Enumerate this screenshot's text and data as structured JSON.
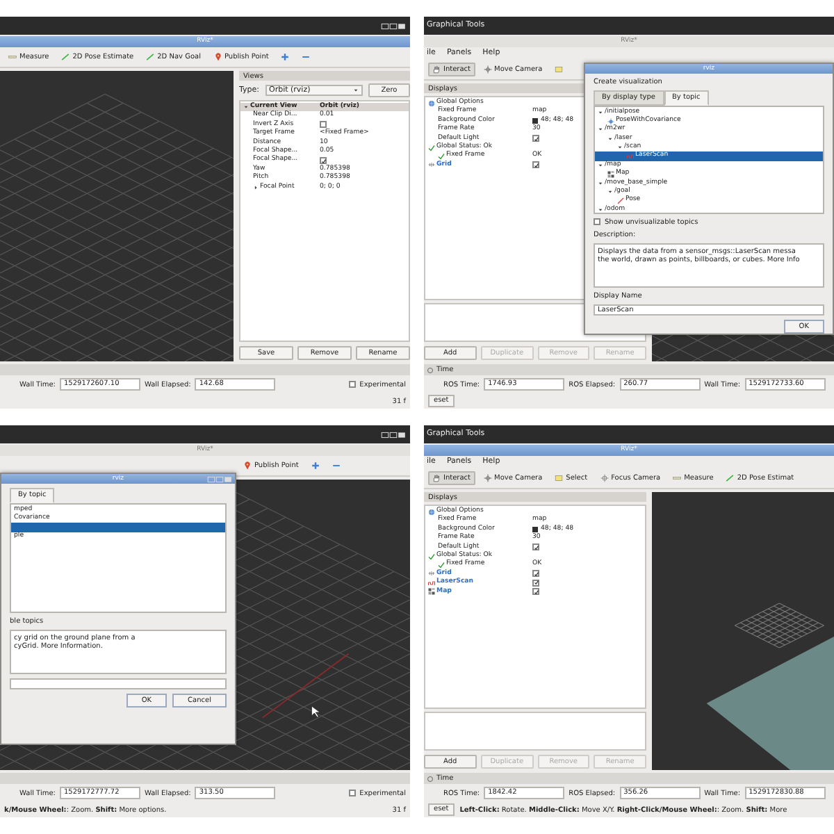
{
  "panels": [
    {
      "window_buttons": true,
      "rviz_title": {
        "text": "RViz*",
        "focused": true
      },
      "tools": [
        {
          "kind": "measure",
          "label": "Measure",
          "selected": false
        },
        {
          "kind": "pose-estimate",
          "label": "2D Pose Estimate",
          "selected": false
        },
        {
          "kind": "nav-goal",
          "label": "2D Nav Goal",
          "selected": false
        },
        {
          "kind": "point",
          "label": "Publish Point",
          "selected": false
        },
        {
          "kind": "plus",
          "selected": false
        },
        {
          "kind": "minus",
          "selected": false
        }
      ],
      "scene": {
        "kind": "grid"
      },
      "views": {
        "title": "Views",
        "type_label": "Type:",
        "type_value": "Orbit (rviz)",
        "zero_button": "Zero",
        "tree": [
          {
            "label": "Current View",
            "value": "Orbit (rviz)",
            "expanded": true,
            "children": [
              {
                "label": "Near Clip Di...",
                "value": "0.01"
              },
              {
                "label": "Invert Z Axis",
                "checked": false
              },
              {
                "label": "Target Frame",
                "value": "<Fixed Frame>"
              },
              {
                "label": "Distance",
                "value": "10"
              },
              {
                "label": "Focal Shape...",
                "value": "0.05"
              },
              {
                "label": "Focal Shape...",
                "checked": true
              },
              {
                "label": "Yaw",
                "value": "0.785398"
              },
              {
                "label": "Pitch",
                "value": "0.785398"
              },
              {
                "label": "Focal Point",
                "value": "0; 0; 0",
                "expanded": false
              }
            ]
          }
        ],
        "buttons": [
          {
            "label": "Save",
            "disabled": false
          },
          {
            "label": "Remove",
            "disabled": false
          },
          {
            "label": "Rename",
            "disabled": false
          }
        ]
      },
      "time": {
        "fields": [
          {
            "label": "Wall Time:",
            "value": "1529172607.10"
          },
          {
            "label": "Wall Elapsed:",
            "value": "142.68"
          }
        ],
        "experimental": {
          "label": "Experimental",
          "checked": false
        }
      },
      "status": {
        "fps": "31 f"
      }
    },
    {
      "window_title": "Graphical Tools",
      "rviz_title": {
        "text": "RViz*",
        "focused": false
      },
      "menu": [
        "ile",
        "Panels",
        "Help"
      ],
      "tools": [
        {
          "kind": "hand",
          "label": "Interact",
          "selected": true
        },
        {
          "kind": "move",
          "label": "Move Camera",
          "selected": false
        },
        {
          "kind": "select",
          "selected": false
        }
      ],
      "scene": {
        "kind": "grid"
      },
      "displays": {
        "title": "Displays",
        "tree": [
          {
            "kind": "options",
            "label": "Global Options",
            "children": [
              {
                "kind": "property",
                "label": "Fixed Frame",
                "value": "map"
              },
              {
                "kind": "property",
                "label": "Background Color",
                "value": "48; 48; 48",
                "color": "#303030"
              },
              {
                "kind": "property",
                "label": "Frame Rate",
                "value": "30"
              },
              {
                "kind": "property",
                "label": "Default Light",
                "checked": true
              }
            ]
          },
          {
            "kind": "status",
            "label": "Global Status: Ok",
            "children": [
              {
                "kind": "status",
                "label": "Fixed Frame",
                "value": "OK"
              }
            ]
          },
          {
            "kind": "grid",
            "label": "Grid",
            "checked": true
          }
        ],
        "buttons": [
          {
            "label": "Add",
            "disabled": false
          },
          {
            "label": "Duplicate",
            "disabled": true
          },
          {
            "label": "Remove",
            "disabled": true
          },
          {
            "label": "Rename",
            "disabled": true
          }
        ]
      },
      "dialog": {
        "title": "rviz",
        "heading": "Create visualization",
        "tabs": [
          {
            "label": "By display type",
            "selected": false
          },
          {
            "label": "By topic",
            "selected": true
          }
        ],
        "tree": [
          {
            "label": "/initialpose",
            "expanded": true,
            "selected": false,
            "children": [
              {
                "kind": "covariance",
                "label": "PoseWithCovariance",
                "selected": false
              }
            ]
          },
          {
            "label": "/m2wr",
            "expanded": true,
            "selected": false,
            "children": [
              {
                "label": "/laser",
                "expanded": true,
                "selected": false,
                "children": [
                  {
                    "label": "/scan",
                    "expanded": true,
                    "selected": false,
                    "children": [
                      {
                        "kind": "laser",
                        "label": "LaserScan",
                        "selected": true
                      }
                    ]
                  }
                ]
              }
            ]
          },
          {
            "label": "/map",
            "expanded": true,
            "selected": false,
            "children": [
              {
                "kind": "map",
                "label": "Map",
                "selected": false
              }
            ]
          },
          {
            "label": "/move_base_simple",
            "expanded": true,
            "selected": false,
            "children": [
              {
                "label": "/goal",
                "expanded": true,
                "selected": false,
                "children": [
                  {
                    "kind": "pose",
                    "label": "Pose",
                    "selected": false
                  }
                ]
              }
            ]
          },
          {
            "label": "/odom",
            "expanded": true,
            "selected": false
          }
        ],
        "show_unvisualizable": {
          "label": "Show unvisualizable topics",
          "checked": false
        },
        "description_label": "Description:",
        "description": {
          "lines": [
            "Displays the data from a sensor_msgs::LaserScan messa",
            "the world, drawn as points, billboards, or cubes."
          ],
          "link": "More Info"
        },
        "name_label": "Display Name",
        "name_value": "LaserScan",
        "buttons": [
          "OK"
        ]
      },
      "time": {
        "title": "Time",
        "fields": [
          {
            "label": "ROS Time:",
            "value": "1746.93"
          },
          {
            "label": "ROS Elapsed:",
            "value": "260.77"
          },
          {
            "label": "Wall Time:",
            "value": "1529172733.60"
          }
        ]
      },
      "status": {
        "button": "eset"
      }
    },
    {
      "window_buttons": true,
      "rviz_title": {
        "text": "RViz*",
        "focused": false
      },
      "tools": [
        {
          "kind": "point",
          "label": "Publish Point",
          "selected": false
        },
        {
          "kind": "plus",
          "selected": false
        },
        {
          "kind": "minus",
          "selected": false
        }
      ],
      "scene": {
        "kind": "grid-axis"
      },
      "dialog": {
        "title": "rviz",
        "window_buttons": true,
        "tabs": [
          {
            "label": "By topic",
            "selected": true
          }
        ],
        "tree": [
          {
            "label": "mped",
            "selected": false
          },
          {
            "label": "Covariance",
            "selected": false
          },
          {
            "selected": true
          },
          {
            "label": "ple",
            "selected": false
          }
        ],
        "show_unvisualizable": {
          "label": "ble topics"
        },
        "description": {
          "lines": [
            "cy grid on the ground plane from a",
            "cyGrid."
          ],
          "link": "More Information",
          "after": "."
        },
        "buttons": [
          "OK",
          "Cancel"
        ]
      },
      "time": {
        "fields": [
          {
            "label": "Wall Time:",
            "value": "1529172777.72"
          },
          {
            "label": "Wall Elapsed:",
            "value": "313.50"
          }
        ],
        "experimental": {
          "label": "Experimental",
          "checked": false
        }
      },
      "status": {
        "text": "**k/Mouse Wheel:**: Zoom. **Shift:** More options.",
        "fps": "31 f"
      }
    },
    {
      "window_title": "Graphical Tools",
      "rviz_title": {
        "text": "RViz*",
        "focused": true
      },
      "menu": [
        "ile",
        "Panels",
        "Help"
      ],
      "tools": [
        {
          "kind": "hand",
          "label": "Interact",
          "selected": true
        },
        {
          "kind": "move",
          "label": "Move Camera",
          "selected": false
        },
        {
          "kind": "select",
          "label": "Select",
          "selected": false
        },
        {
          "kind": "focus",
          "label": "Focus Camera",
          "selected": false
        },
        {
          "kind": "measure",
          "label": "Measure",
          "selected": false
        },
        {
          "kind": "pose-estimate",
          "label": "2D Pose Estimat",
          "selected": false
        }
      ],
      "scene": {
        "kind": "map"
      },
      "displays": {
        "title": "Displays",
        "tree": [
          {
            "kind": "options",
            "label": "Global Options",
            "children": [
              {
                "kind": "property",
                "label": "Fixed Frame",
                "value": "map"
              },
              {
                "kind": "property",
                "label": "Background Color",
                "value": "48; 48; 48",
                "color": "#303030"
              },
              {
                "kind": "property",
                "label": "Frame Rate",
                "value": "30"
              },
              {
                "kind": "property",
                "label": "Default Light",
                "checked": true
              }
            ]
          },
          {
            "kind": "status",
            "label": "Global Status: Ok",
            "children": [
              {
                "kind": "status",
                "label": "Fixed Frame",
                "value": "OK"
              }
            ]
          },
          {
            "kind": "grid",
            "label": "Grid",
            "checked": true
          },
          {
            "kind": "laser",
            "label": "LaserScan",
            "checked": true
          },
          {
            "kind": "map",
            "label": "Map",
            "checked": true
          }
        ],
        "buttons": [
          {
            "label": "Add",
            "disabled": false
          },
          {
            "label": "Duplicate",
            "disabled": true
          },
          {
            "label": "Remove",
            "disabled": true
          },
          {
            "label": "Rename",
            "disabled": true
          }
        ]
      },
      "time": {
        "title": "Time",
        "fields": [
          {
            "label": "ROS Time:",
            "value": "1842.42"
          },
          {
            "label": "ROS Elapsed:",
            "value": "356.26"
          },
          {
            "label": "Wall Time:",
            "value": "1529172830.88"
          }
        ]
      },
      "status": {
        "button": "eset",
        "text": "**Left-Click:** Rotate. **Middle-Click:** Move X/Y. **Right-Click/Mouse Wheel:**: Zoom. **Shift:** More"
      }
    }
  ]
}
